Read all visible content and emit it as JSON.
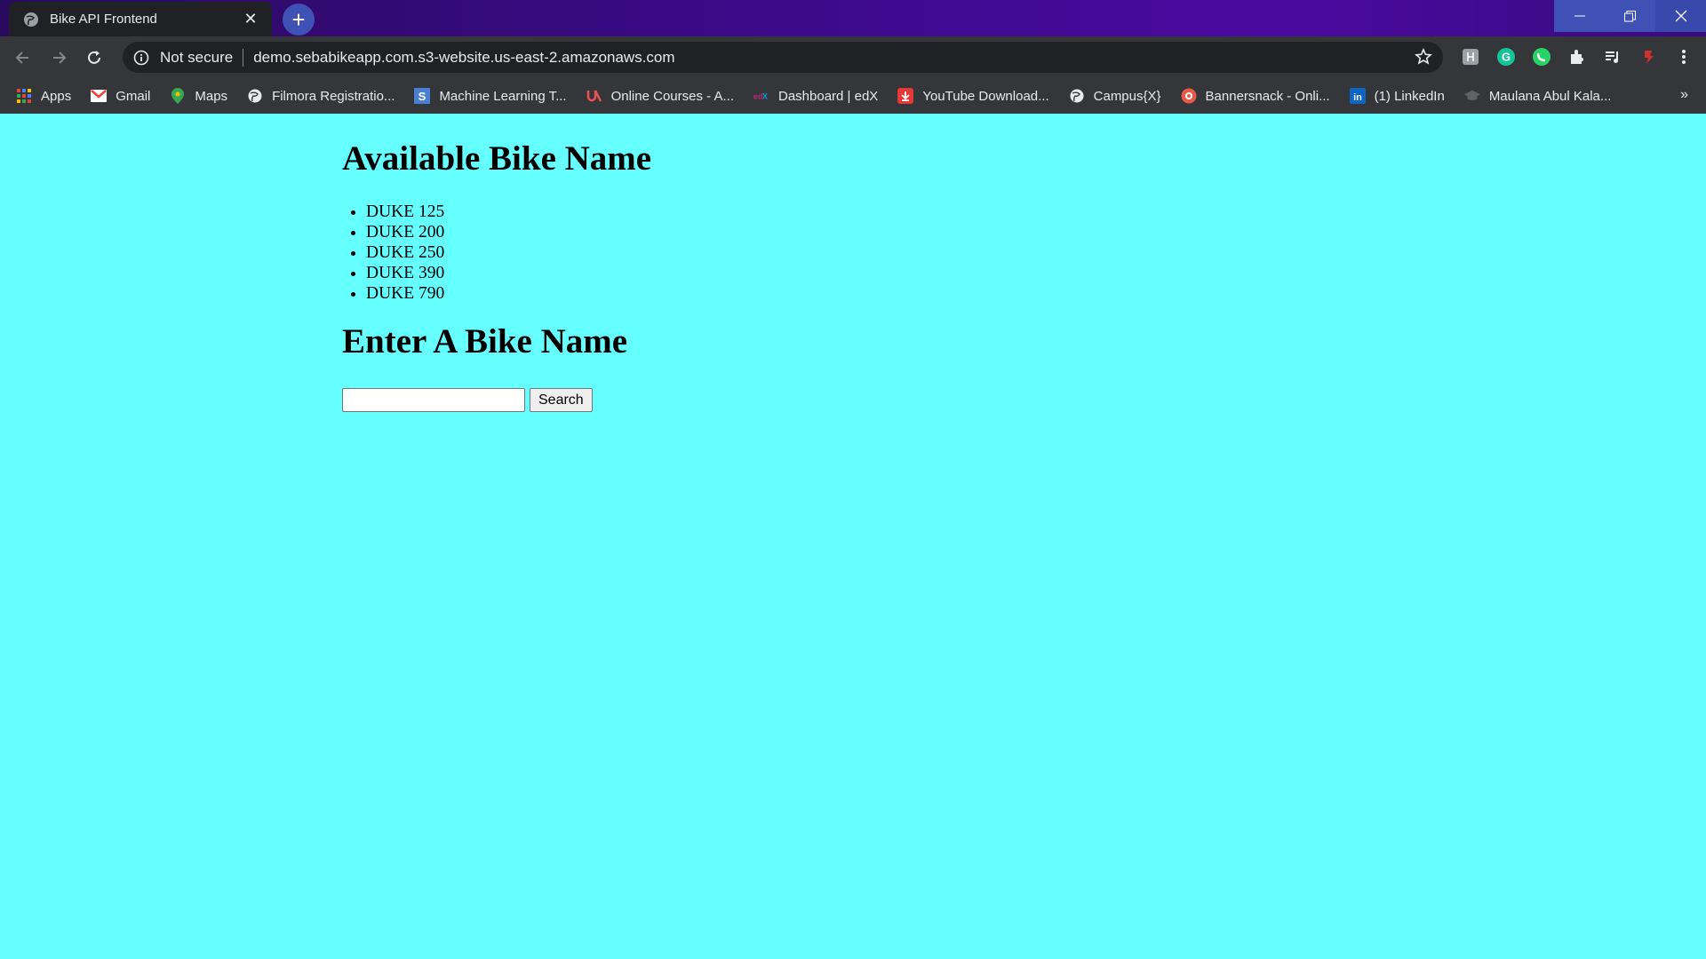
{
  "browser": {
    "tab_title": "Bike API Frontend",
    "address": {
      "security_label": "Not secure",
      "url": "demo.sebabikeapp.com.s3-website.us-east-2.amazonaws.com"
    },
    "bookmarks": [
      {
        "label": "Apps",
        "icon": "apps-grid-icon"
      },
      {
        "label": "Gmail",
        "icon": "gmail-icon"
      },
      {
        "label": "Maps",
        "icon": "maps-pin-icon"
      },
      {
        "label": "Filmora Registratio...",
        "icon": "globe-icon"
      },
      {
        "label": "Machine Learning T...",
        "icon": "s-logo-icon"
      },
      {
        "label": "Online Courses - A...",
        "icon": "udemy-icon"
      },
      {
        "label": "Dashboard | edX",
        "icon": "edx-icon"
      },
      {
        "label": "YouTube Download...",
        "icon": "download-icon"
      },
      {
        "label": "Campus{X}",
        "icon": "globe-icon"
      },
      {
        "label": "Bannersnack - Onli...",
        "icon": "bannersnack-icon"
      },
      {
        "label": "(1) LinkedIn",
        "icon": "linkedin-icon"
      },
      {
        "label": "Maulana Abul Kala...",
        "icon": "graduation-cap-icon"
      }
    ],
    "more_bookmarks": "»"
  },
  "page": {
    "heading_available": "Available Bike Name",
    "bikes": [
      "DUKE 125",
      "DUKE 200",
      "DUKE 250",
      "DUKE 390",
      "DUKE 790"
    ],
    "heading_enter": "Enter A Bike Name",
    "search_value": "",
    "search_button": "Search"
  },
  "colors": {
    "page_background": "#66ffff",
    "toolbar": "#35363a",
    "titlebar_accent": "#3f51b5"
  }
}
